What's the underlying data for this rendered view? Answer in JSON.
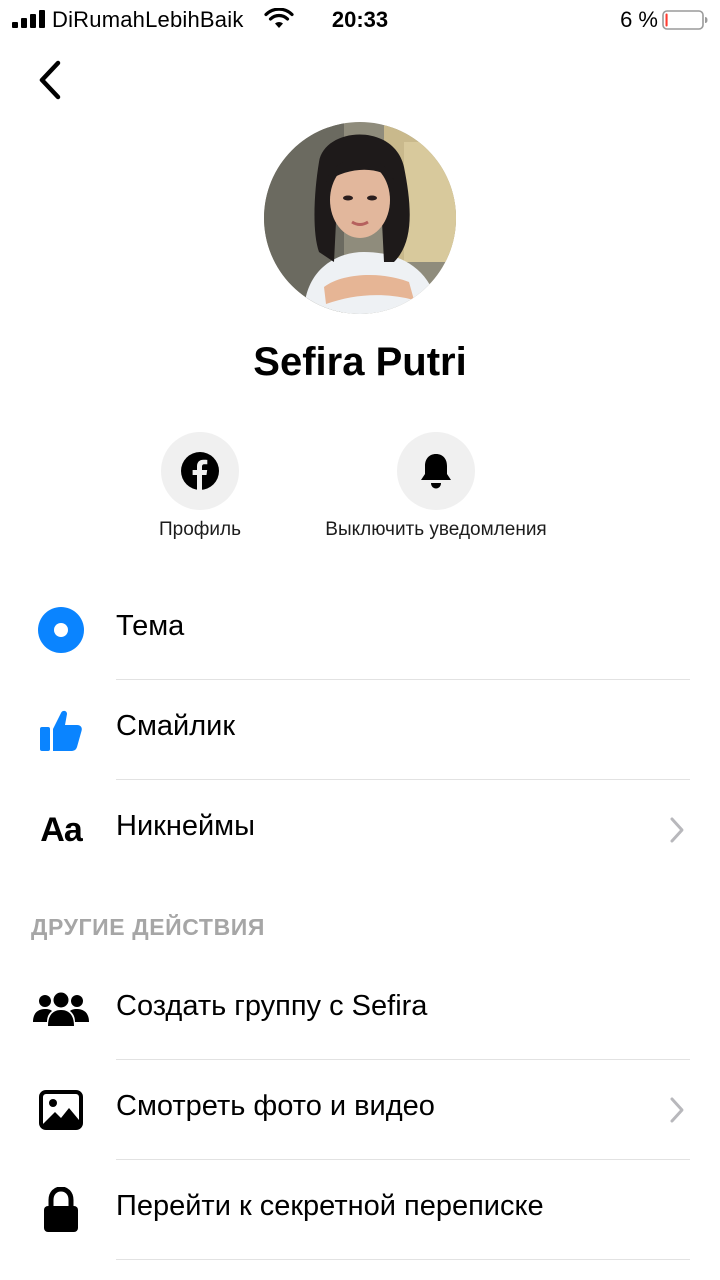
{
  "status_bar": {
    "carrier": "DiRumahLebihBaik",
    "time": "20:33",
    "battery_percent": "6 %",
    "battery_level": 0.06,
    "icons": [
      "signal-icon",
      "wifi-icon",
      "battery-icon"
    ]
  },
  "nav": {
    "back_icon": "chevron-left-icon"
  },
  "profile": {
    "name": "Sefira Putri"
  },
  "actions": [
    {
      "label": "Профиль",
      "icon": "facebook-icon"
    },
    {
      "label": "Выключить уведомления",
      "icon": "bell-icon"
    }
  ],
  "settings": [
    {
      "label": "Тема",
      "icon": "theme-icon",
      "chevron": false
    },
    {
      "label": "Смайлик",
      "icon": "thumbs-up-icon",
      "chevron": false
    },
    {
      "label": "Никнеймы",
      "icon": "aa-icon",
      "icon_text": "Aa",
      "chevron": true
    }
  ],
  "other_actions": {
    "title": "ДРУГИЕ ДЕЙСТВИЯ",
    "items": [
      {
        "label": "Создать группу с Sefira",
        "icon": "group-icon",
        "chevron": false
      },
      {
        "label": "Смотреть фото и видео",
        "icon": "photo-icon",
        "chevron": true
      },
      {
        "label": "Перейти к секретной переписке",
        "icon": "lock-icon",
        "chevron": false
      }
    ]
  },
  "colors": {
    "accent": "#0a84ff",
    "secondary_text": "#a6a6a6",
    "divider": "#e2e2e2",
    "action_circle": "#f0f0f0"
  }
}
